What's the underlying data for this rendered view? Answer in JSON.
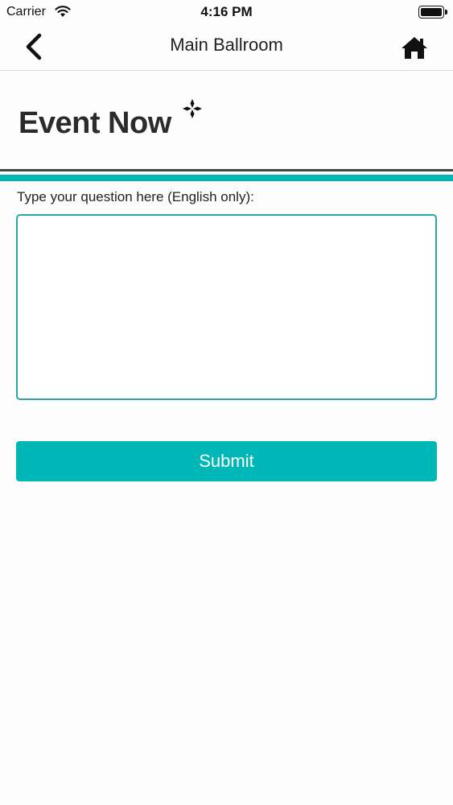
{
  "status_bar": {
    "carrier": "Carrier",
    "time": "4:16 PM",
    "icons": [
      "wifi-icon",
      "battery-icon"
    ]
  },
  "nav": {
    "title": "Main Ballroom",
    "back_icon": "chevron-left-icon",
    "home_icon": "home-icon"
  },
  "logo": {
    "text": "Event Now",
    "mark_icon": "sparkle-icon"
  },
  "colors": {
    "accent": "#00b7b7",
    "input_border": "#27a7a5",
    "divider_dark": "#444444",
    "text": "#222222"
  },
  "form": {
    "label": "Type your question here (English only):",
    "question_value": "",
    "question_placeholder": "",
    "submit_label": "Submit"
  }
}
